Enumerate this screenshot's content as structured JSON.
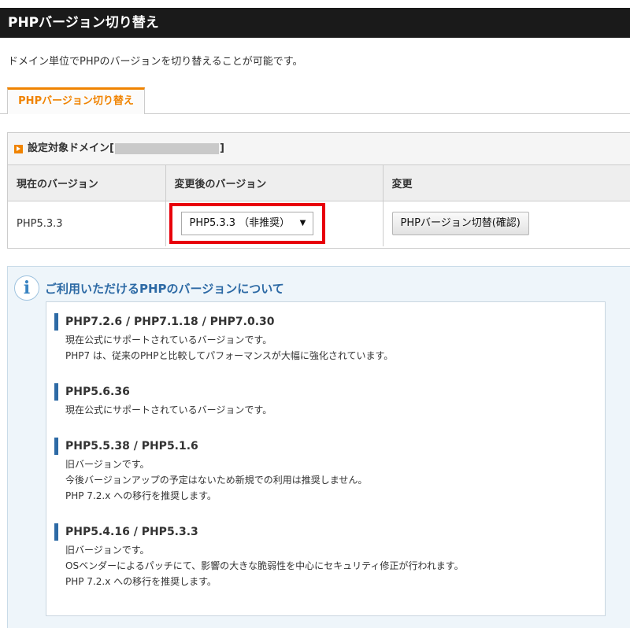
{
  "header": {
    "title": "PHPバージョン切り替え"
  },
  "intro": "ドメイン単位でPHPのバージョンを切り替えることが可能です。",
  "tab": {
    "label": "PHPバージョン切り替え"
  },
  "panel": {
    "title_prefix": "設定対象ドメイン[",
    "title_suffix": "]",
    "columns": [
      "現在のバージョン",
      "変更後のバージョン",
      "変更"
    ],
    "current_version": "PHP5.3.3",
    "select_value": "PHP5.3.3 （非推奨）",
    "button_label": "PHPバージョン切替(確認)"
  },
  "info": {
    "icon_glyph": "i",
    "title": "ご利用いただけるPHPのバージョンについて",
    "blocks": [
      {
        "heading": "PHP7.2.6 / PHP7.1.18 / PHP7.0.30",
        "lines": [
          "現在公式にサポートされているバージョンです。",
          "PHP7 は、従来のPHPと比較してパフォーマンスが大幅に強化されています。"
        ]
      },
      {
        "heading": "PHP5.6.36",
        "lines": [
          "現在公式にサポートされているバージョンです。"
        ]
      },
      {
        "heading": "PHP5.5.38 / PHP5.1.6",
        "lines": [
          "旧バージョンです。",
          "今後バージョンアップの予定はないため新規での利用は推奨しません。",
          "PHP 7.2.x への移行を推奨します。"
        ]
      },
      {
        "heading": "PHP5.4.16 / PHP5.3.3",
        "lines": [
          "旧バージョンです。",
          "OSベンダーによるパッチにて、影響の大きな脆弱性を中心にセキュリティ修正が行われます。",
          "PHP 7.2.x への移行を推奨します。"
        ]
      }
    ]
  },
  "colors": {
    "accent": "#f08300",
    "highlight": "#e8000b",
    "info_blue": "#2d6aa5",
    "header_bg": "#1a1a1a"
  }
}
